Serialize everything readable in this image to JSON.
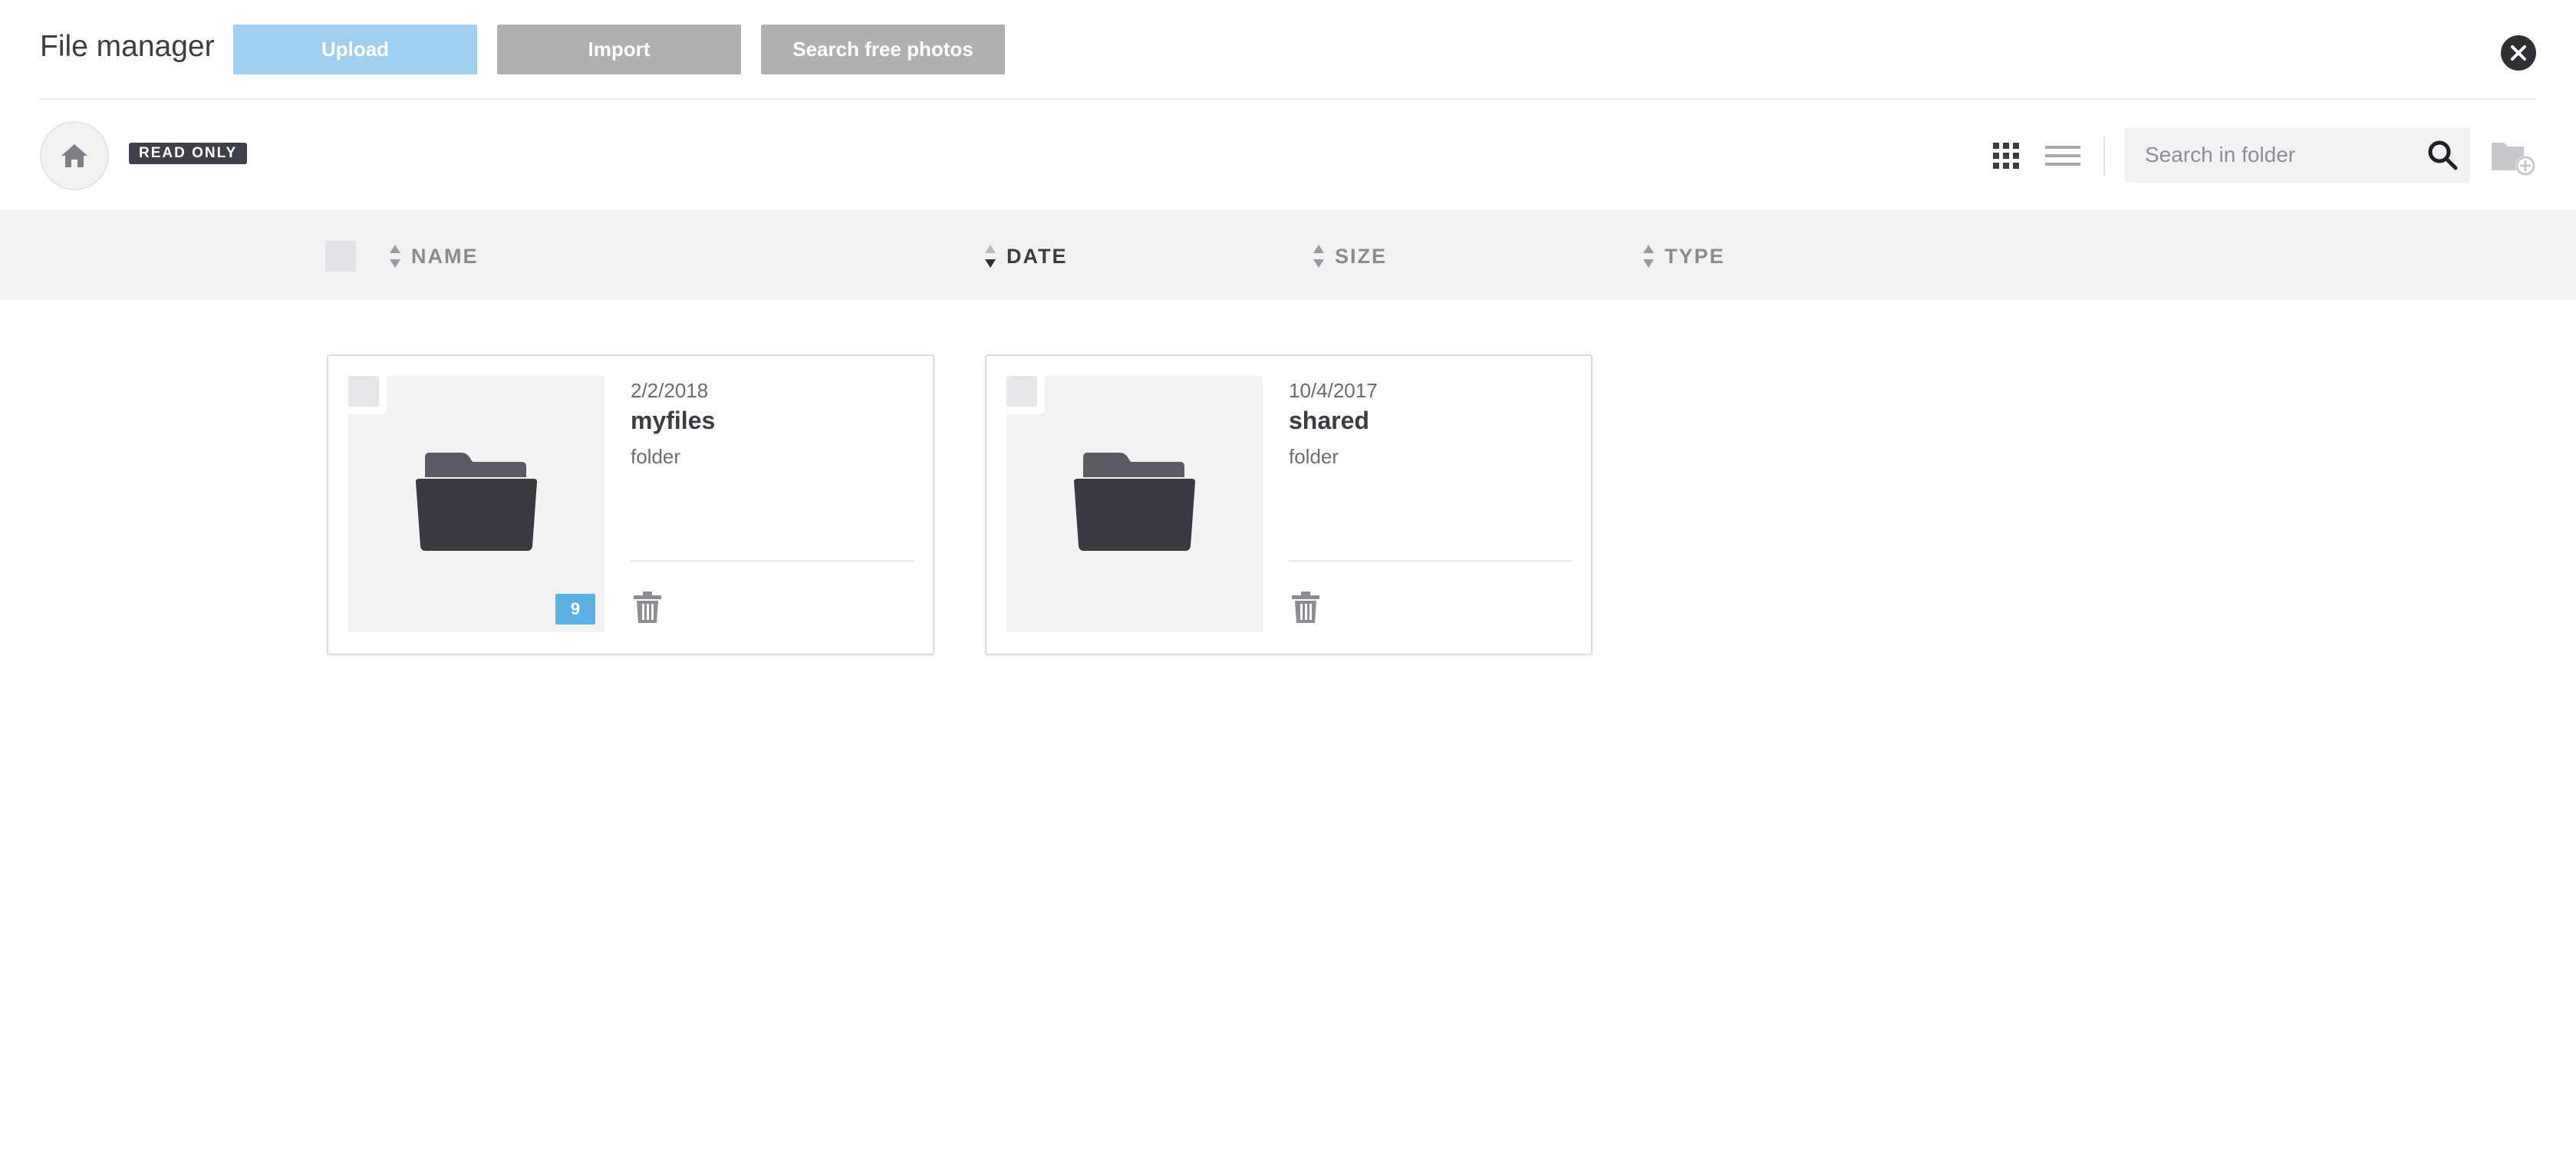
{
  "header": {
    "title": "File manager",
    "upload_label": "Upload",
    "import_label": "Import",
    "search_photos_label": "Search free photos",
    "close_icon": "close-icon"
  },
  "toolbar": {
    "home_icon": "home-icon",
    "read_only_label": "READ ONLY",
    "grid_view_icon": "grid-icon",
    "list_view_icon": "list-icon",
    "search_placeholder": "Search in folder",
    "search_value": "",
    "search_icon": "search-icon",
    "new_folder_icon": "folder-plus-icon"
  },
  "columns": [
    {
      "label": "NAME",
      "sort": "none"
    },
    {
      "label": "DATE",
      "sort": "descending"
    },
    {
      "label": "SIZE",
      "sort": "none"
    },
    {
      "label": "TYPE",
      "sort": "none"
    }
  ],
  "items": [
    {
      "date": "2/2/2018",
      "name": "myfiles",
      "type": "folder",
      "count": "9"
    },
    {
      "date": "10/4/2017",
      "name": "shared",
      "type": "folder",
      "count": null
    }
  ],
  "colors": {
    "upload_button": "#9fd0f0",
    "secondary_button": "#b0b0b3",
    "badge_dark": "#3f4148",
    "count_badge": "#5fb0e5",
    "header_row": "#f1f2f4"
  }
}
